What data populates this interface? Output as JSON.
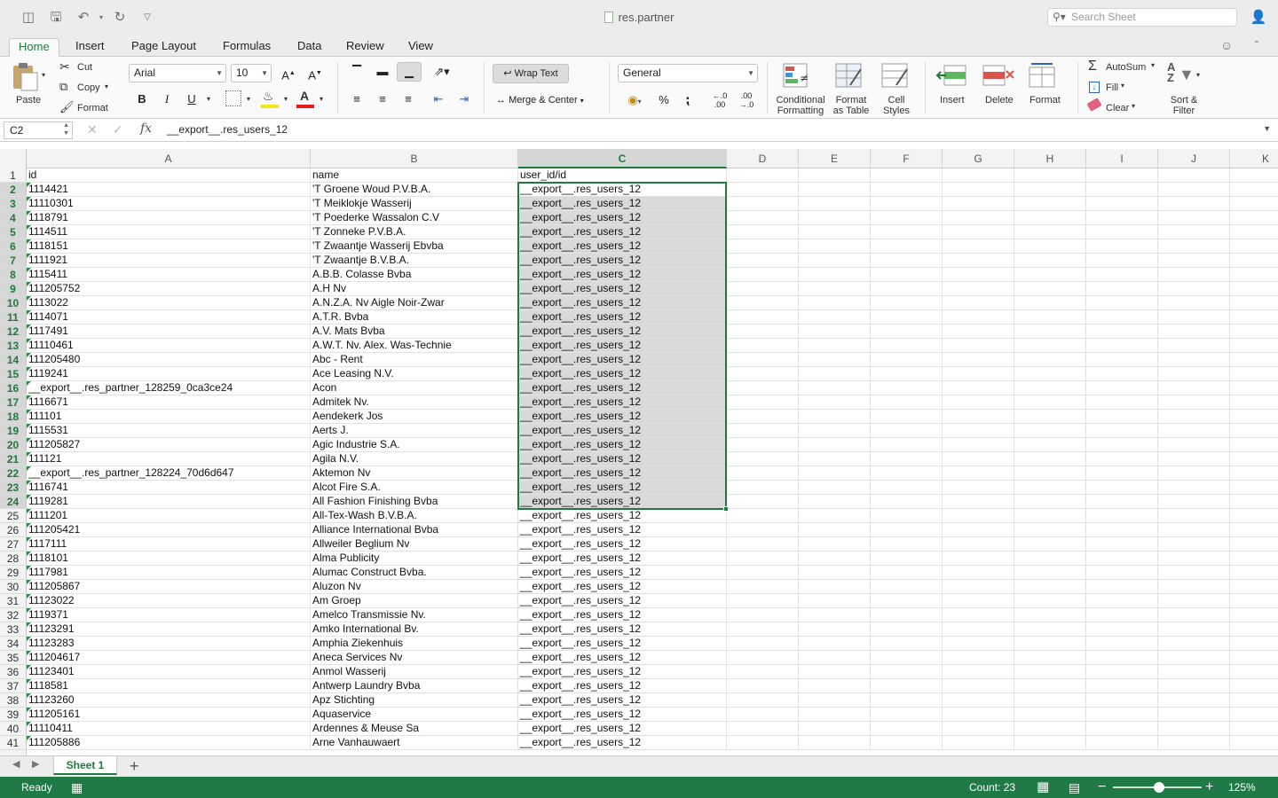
{
  "window": {
    "title": "res.partner",
    "search_placeholder": "Search Sheet"
  },
  "tabs": [
    "Home",
    "Insert",
    "Page Layout",
    "Formulas",
    "Data",
    "Review",
    "View"
  ],
  "active_tab": "Home",
  "ribbon": {
    "paste": "Paste",
    "cut": "Cut",
    "copy": "Copy",
    "format_painter": "Format",
    "font_name": "Arial",
    "font_size": "10",
    "bold": "B",
    "italic": "I",
    "underline": "U",
    "wrap_text": "Wrap Text",
    "merge_center": "Merge & Center",
    "number_format": "General",
    "percent": "%",
    "conditional_formatting_1": "Conditional",
    "conditional_formatting_2": "Formatting",
    "format_as_table_1": "Format",
    "format_as_table_2": "as Table",
    "cell_styles_1": "Cell",
    "cell_styles_2": "Styles",
    "insert": "Insert",
    "delete": "Delete",
    "format": "Format",
    "autosum": "AutoSum",
    "fill": "Fill",
    "clear": "Clear",
    "sort_filter_1": "Sort &",
    "sort_filter_2": "Filter"
  },
  "formula_bar": {
    "name_box": "C2",
    "fx": "fx",
    "formula": "__export__.res_users_12"
  },
  "columns": [
    "A",
    "B",
    "C",
    "D",
    "E",
    "F",
    "G",
    "H",
    "I",
    "J",
    "K"
  ],
  "selected_column": "C",
  "rows": [
    {
      "n": "1",
      "a": "id",
      "b": "name",
      "c": "user_id/id"
    },
    {
      "n": "2",
      "a": "1114421",
      "b": "'T Groene Woud P.V.B.A.",
      "c": "__export__.res_users_12"
    },
    {
      "n": "3",
      "a": "11110301",
      "b": "'T Meiklokje   Wasserij",
      "c": "__export__.res_users_12"
    },
    {
      "n": "4",
      "a": "1118791",
      "b": "'T Poederke   Wassalon C.V",
      "c": "__export__.res_users_12"
    },
    {
      "n": "5",
      "a": "1114511",
      "b": "'T Zonneke P.V.B.A.",
      "c": "__export__.res_users_12"
    },
    {
      "n": "6",
      "a": "1118151",
      "b": "'T Zwaantje  Wasserij  Ebvba",
      "c": "__export__.res_users_12"
    },
    {
      "n": "7",
      "a": "1111921",
      "b": "'T Zwaantje B.V.B.A.",
      "c": "__export__.res_users_12"
    },
    {
      "n": "8",
      "a": "1115411",
      "b": "A.B.B. Colasse Bvba",
      "c": "__export__.res_users_12"
    },
    {
      "n": "9",
      "a": "111205752",
      "b": "A.H Nv",
      "c": "__export__.res_users_12"
    },
    {
      "n": "10",
      "a": "1113022",
      "b": "A.N.Z.A. Nv  Aigle Noir-Zwar",
      "c": "__export__.res_users_12"
    },
    {
      "n": "11",
      "a": "1114071",
      "b": "A.T.R.  Bvba",
      "c": "__export__.res_users_12"
    },
    {
      "n": "12",
      "a": "1117491",
      "b": "A.V. Mats Bvba",
      "c": "__export__.res_users_12"
    },
    {
      "n": "13",
      "a": "11110461",
      "b": "A.W.T. Nv. Alex. Was-Technie",
      "c": "__export__.res_users_12"
    },
    {
      "n": "14",
      "a": "111205480",
      "b": "Abc - Rent",
      "c": "__export__.res_users_12"
    },
    {
      "n": "15",
      "a": "1119241",
      "b": "Ace Leasing N.V.",
      "c": "__export__.res_users_12"
    },
    {
      "n": "16",
      "a": "__export__.res_partner_128259_0ca3ce24",
      "b": "Acon",
      "c": "__export__.res_users_12"
    },
    {
      "n": "17",
      "a": "1116671",
      "b": "Admitek  Nv.",
      "c": "__export__.res_users_12"
    },
    {
      "n": "18",
      "a": "111101",
      "b": "Aendekerk Jos",
      "c": "__export__.res_users_12"
    },
    {
      "n": "19",
      "a": "1115531",
      "b": "Aerts  J.",
      "c": "__export__.res_users_12"
    },
    {
      "n": "20",
      "a": "111205827",
      "b": "Agic Industrie S.A.",
      "c": "__export__.res_users_12"
    },
    {
      "n": "21",
      "a": "111121",
      "b": "Agila  N.V.",
      "c": "__export__.res_users_12"
    },
    {
      "n": "22",
      "a": "__export__.res_partner_128224_70d6d647",
      "b": "Aktemon Nv",
      "c": "__export__.res_users_12"
    },
    {
      "n": "23",
      "a": "1116741",
      "b": "Alcot Fire  S.A.",
      "c": "__export__.res_users_12"
    },
    {
      "n": "24",
      "a": "1119281",
      "b": "All Fashion Finishing Bvba",
      "c": "__export__.res_users_12"
    },
    {
      "n": "25",
      "a": "1111201",
      "b": "All-Tex-Wash B.V.B.A.",
      "c": "__export__.res_users_12"
    },
    {
      "n": "26",
      "a": "111205421",
      "b": "Alliance International Bvba",
      "c": "__export__.res_users_12"
    },
    {
      "n": "27",
      "a": "1117111",
      "b": "Allweiler Beglium Nv",
      "c": "__export__.res_users_12"
    },
    {
      "n": "28",
      "a": "1118101",
      "b": "Alma Publicity",
      "c": "__export__.res_users_12"
    },
    {
      "n": "29",
      "a": "1117981",
      "b": "Alumac Construct Bvba.",
      "c": "__export__.res_users_12"
    },
    {
      "n": "30",
      "a": "111205867",
      "b": "Aluzon Nv",
      "c": "__export__.res_users_12"
    },
    {
      "n": "31",
      "a": "11123022",
      "b": "Am Groep",
      "c": "__export__.res_users_12"
    },
    {
      "n": "32",
      "a": "1119371",
      "b": "Amelco Transmissie Nv.",
      "c": "__export__.res_users_12"
    },
    {
      "n": "33",
      "a": "11123291",
      "b": "Amko  International  Bv.",
      "c": "__export__.res_users_12"
    },
    {
      "n": "34",
      "a": "11123283",
      "b": "Amphia Ziekenhuis",
      "c": "__export__.res_users_12"
    },
    {
      "n": "35",
      "a": "111204617",
      "b": "Aneca Services  Nv",
      "c": "__export__.res_users_12"
    },
    {
      "n": "36",
      "a": "11123401",
      "b": "Anmol   Wasserij",
      "c": "__export__.res_users_12"
    },
    {
      "n": "37",
      "a": "1118581",
      "b": "Antwerp Laundry Bvba",
      "c": "__export__.res_users_12"
    },
    {
      "n": "38",
      "a": "11123260",
      "b": "Apz Stichting",
      "c": "__export__.res_users_12"
    },
    {
      "n": "39",
      "a": "111205161",
      "b": "Aquaservice",
      "c": "__export__.res_users_12"
    },
    {
      "n": "40",
      "a": "11110411",
      "b": "Ardennes &  Meuse Sa",
      "c": "__export__.res_users_12"
    },
    {
      "n": "41",
      "a": "111205886",
      "b": "Arne Vanhauwaert",
      "c": "__export__.res_users_12"
    }
  ],
  "sheet_tab": "Sheet 1",
  "status": {
    "ready": "Ready",
    "count": "Count: 23",
    "zoom": "125%",
    "zoom_level_percent": 125
  },
  "colors": {
    "accent": "#1e7b3c",
    "status_bar": "#1f7a45",
    "selection_fill": "#d9d9d9"
  }
}
